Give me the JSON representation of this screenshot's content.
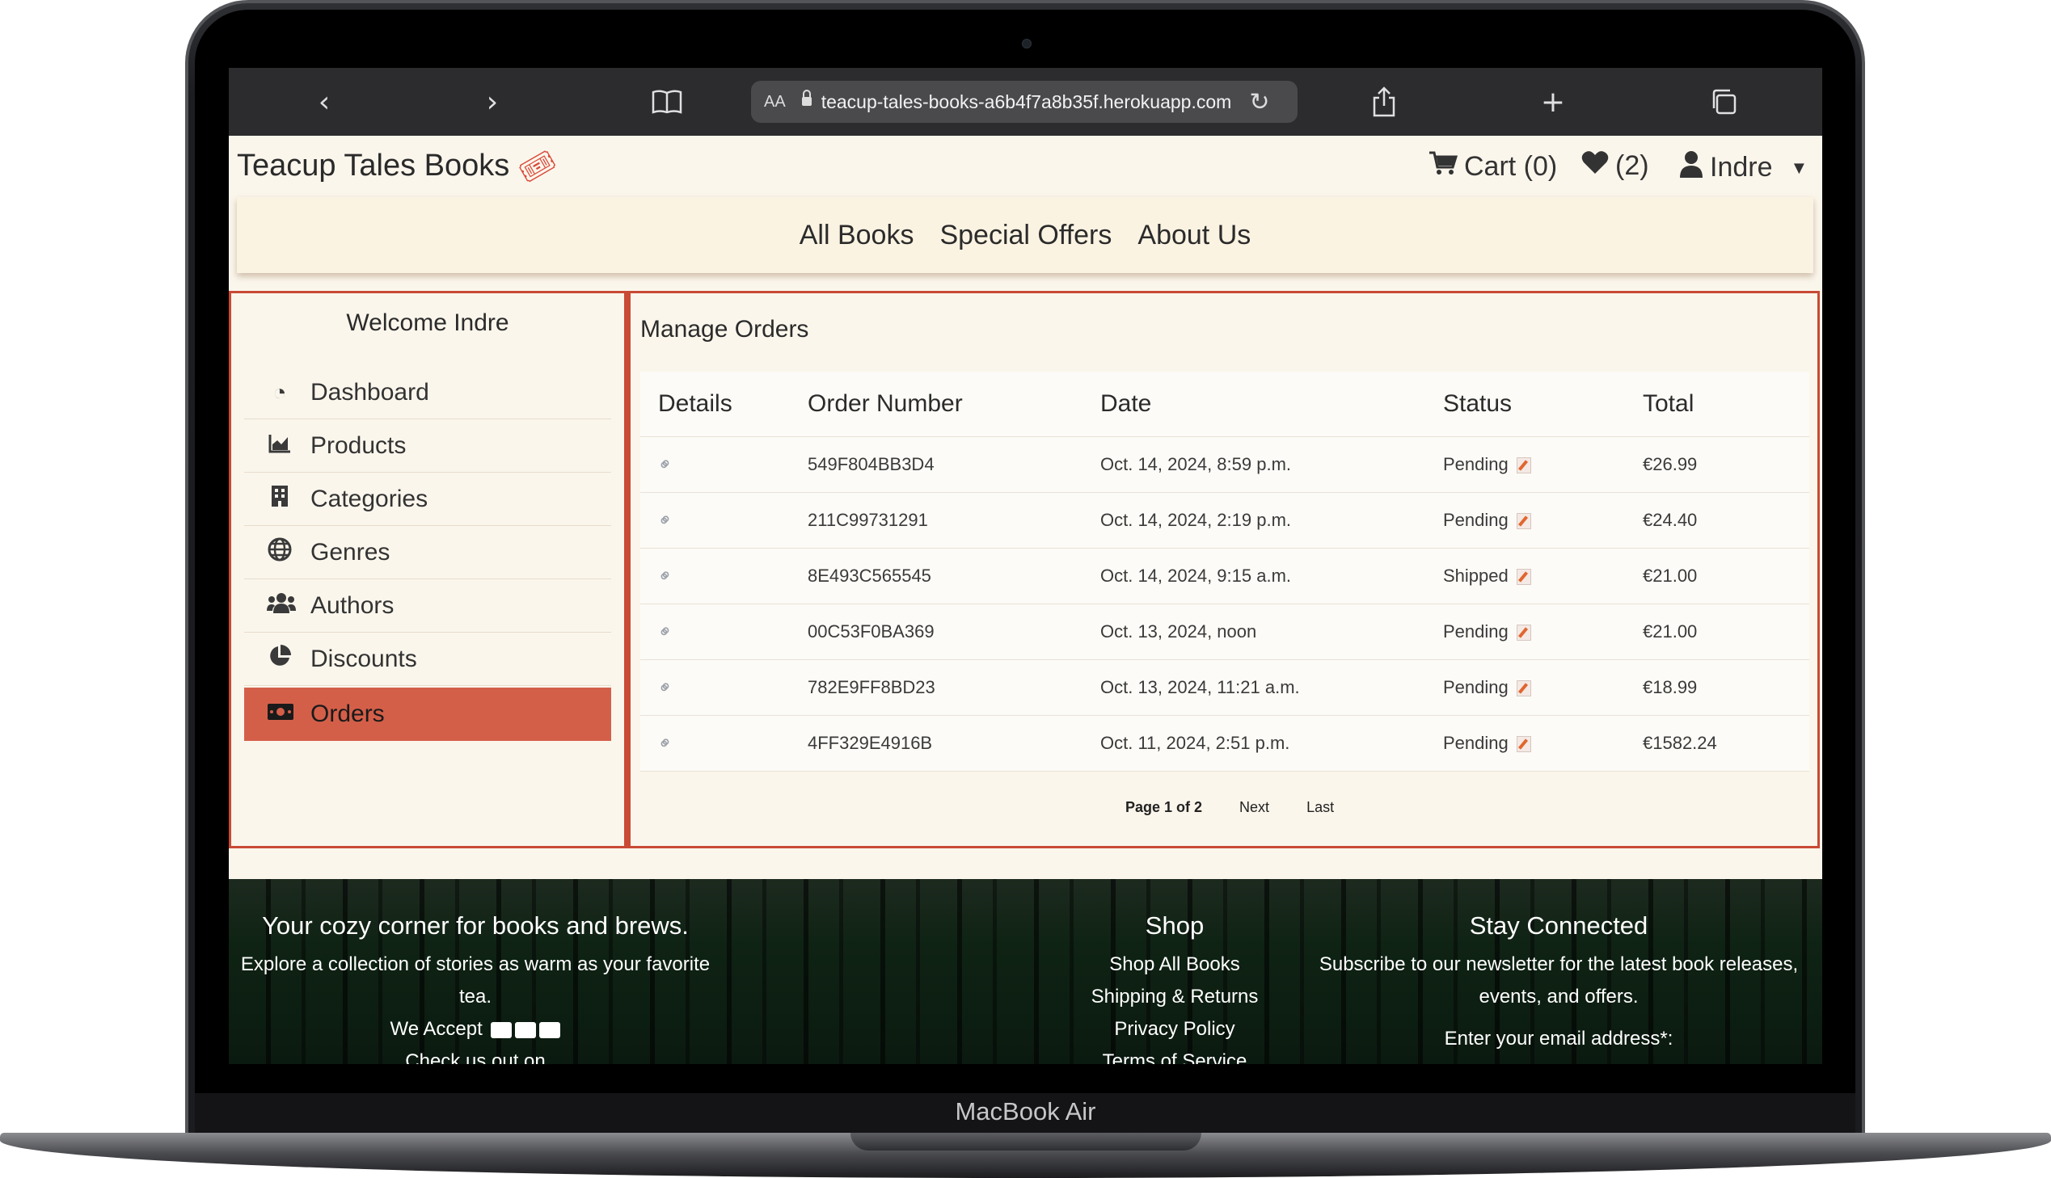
{
  "device": {
    "label": "MacBook Air"
  },
  "browser": {
    "url_prefix": "AA",
    "url": "teacup-tales-books-a6b4f7a8b35f.herokuapp.com"
  },
  "header": {
    "brand": "Teacup Tales Books",
    "cart": "Cart (0)",
    "wishlist": "(2)",
    "user": "Indre"
  },
  "nav": {
    "all_books": "All Books",
    "special_offers": "Special Offers",
    "about_us": "About Us"
  },
  "sidebar": {
    "welcome": "Welcome Indre",
    "items": [
      {
        "label": "Dashboard",
        "icon": "gauge-icon"
      },
      {
        "label": "Products",
        "icon": "chart-icon"
      },
      {
        "label": "Categories",
        "icon": "building-icon"
      },
      {
        "label": "Genres",
        "icon": "globe-icon"
      },
      {
        "label": "Authors",
        "icon": "users-icon"
      },
      {
        "label": "Discounts",
        "icon": "pie-icon"
      },
      {
        "label": "Orders",
        "icon": "money-icon",
        "active": true
      }
    ]
  },
  "orders": {
    "title": "Manage Orders",
    "columns": [
      "Details",
      "Order Number",
      "Date",
      "Status",
      "Total"
    ],
    "rows": [
      {
        "number": "549F804BB3D4",
        "date": "Oct. 14, 2024, 8:59 p.m.",
        "status": "Pending",
        "total": "€26.99"
      },
      {
        "number": "211C99731291",
        "date": "Oct. 14, 2024, 2:19 p.m.",
        "status": "Pending",
        "total": "€24.40"
      },
      {
        "number": "8E493C565545",
        "date": "Oct. 14, 2024, 9:15 a.m.",
        "status": "Shipped",
        "total": "€21.00"
      },
      {
        "number": "00C53F0BA369",
        "date": "Oct. 13, 2024, noon",
        "status": "Pending",
        "total": "€21.00"
      },
      {
        "number": "782E9FF8BD23",
        "date": "Oct. 13, 2024, 11:21 a.m.",
        "status": "Pending",
        "total": "€18.99"
      },
      {
        "number": "4FF329E4916B",
        "date": "Oct. 11, 2024, 2:51 p.m.",
        "status": "Pending",
        "total": "€1582.24"
      }
    ],
    "pagination": {
      "current": "Page 1 of 2",
      "next": "Next",
      "last": "Last"
    }
  },
  "footer": {
    "about": {
      "title": "Your cozy corner for books and brews.",
      "line1": "Explore a collection of stories as warm as your favorite tea.",
      "accept": "We Accept",
      "check": "Check us out on"
    },
    "shop": {
      "title": "Shop",
      "links": [
        "Shop All Books",
        "Shipping & Returns",
        "Privacy Policy",
        "Terms of Service"
      ]
    },
    "connect": {
      "title": "Stay Connected",
      "line1": "Subscribe to our newsletter for the latest book releases,",
      "line2": "events, and offers.",
      "email_label": "Enter your email address*:"
    }
  },
  "colors": {
    "accent": "#d45f49",
    "border": "#c94a35",
    "page_bg": "#fbf6ec"
  }
}
